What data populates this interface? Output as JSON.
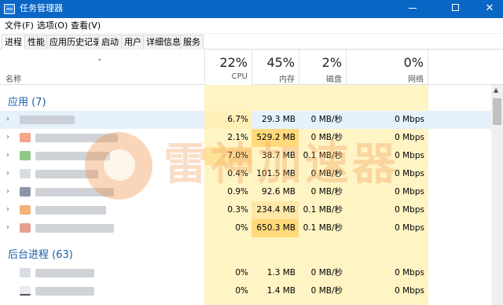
{
  "window": {
    "title": "任务管理器"
  },
  "menu": {
    "items": [
      "文件(F)",
      "选项(O)",
      "查看(V)"
    ]
  },
  "tabs": [
    "进程",
    "性能",
    "应用历史记录",
    "启动",
    "用户",
    "详细信息",
    "服务"
  ],
  "header": {
    "name_label": "名称",
    "cpu": {
      "pct": "22%",
      "label": "CPU"
    },
    "mem": {
      "pct": "45%",
      "label": "内存"
    },
    "disk": {
      "pct": "2%",
      "label": "磁盘"
    },
    "net": {
      "pct": "0%",
      "label": "网络"
    }
  },
  "groups": {
    "apps": "应用 (7)",
    "background": "后台进程 (63)"
  },
  "app_rows": [
    {
      "cpu": "6.7%",
      "mem": "29.3 MB",
      "disk": "0 MB/秒",
      "net": "0 Mbps"
    },
    {
      "cpu": "2.1%",
      "mem": "529.2 MB",
      "disk": "0 MB/秒",
      "net": "0 Mbps"
    },
    {
      "cpu": "7.0%",
      "mem": "38.7 MB",
      "disk": "0.1 MB/秒",
      "net": "0 Mbps"
    },
    {
      "cpu": "0.4%",
      "mem": "101.5 MB",
      "disk": "0 MB/秒",
      "net": "0 Mbps"
    },
    {
      "cpu": "0.9%",
      "mem": "92.6 MB",
      "disk": "0 MB/秒",
      "net": "0 Mbps"
    },
    {
      "cpu": "0.3%",
      "mem": "234.4 MB",
      "disk": "0.1 MB/秒",
      "net": "0 Mbps"
    },
    {
      "cpu": "0%",
      "mem": "650.3 MB",
      "disk": "0.1 MB/秒",
      "net": "0 Mbps"
    }
  ],
  "bg_rows": [
    {
      "cpu": "0%",
      "mem": "1.3 MB",
      "disk": "0 MB/秒",
      "net": "0 Mbps"
    },
    {
      "cpu": "0%",
      "mem": "1.4 MB",
      "disk": "0 MB/秒",
      "net": "0 Mbps"
    }
  ],
  "watermark": {
    "text": "雷神加速器"
  },
  "colors": {
    "titlebar": "#0a66c4",
    "group_text": "#1a5ea8",
    "shade_light": "#fff4c4",
    "shade_mid": "#ffeaa6",
    "shade_strong": "#ffd97a",
    "row_highlight": "#e5f1fb"
  },
  "icons": [
    "app-icon",
    "minimize-icon",
    "maximize-icon",
    "close-icon",
    "sort-caret-icon",
    "chevron-right-icon",
    "scroll-up-icon"
  ]
}
